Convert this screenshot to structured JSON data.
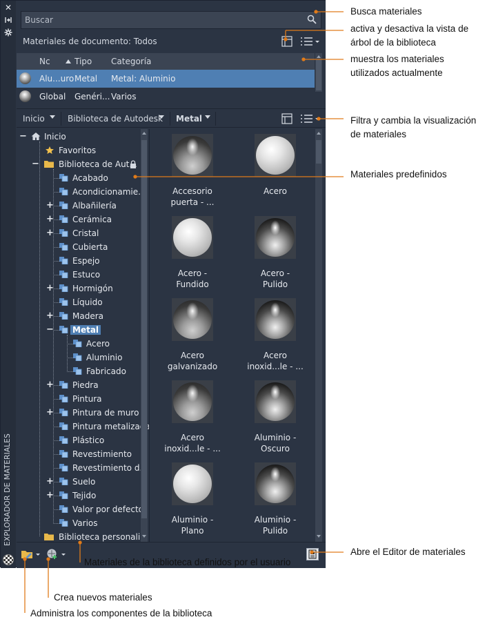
{
  "palette": {
    "title": "EXPLORADOR DE MATERIALES",
    "search": {
      "placeholder": "Buscar",
      "value": ""
    },
    "document": {
      "title": "Materiales de documento: Todos"
    },
    "doc_grid": {
      "columns": [
        "Nc",
        "Tipo",
        "Categoría"
      ],
      "rows": [
        {
          "name": "Alu...uro",
          "type": "Metal",
          "category": "Metal: Aluminio"
        },
        {
          "name": "Global",
          "type": "Genéri...",
          "category": "Varios"
        }
      ]
    },
    "library_bar": {
      "crumbs": [
        "Inicio",
        "Biblioteca de Autodesk",
        "Metal"
      ]
    },
    "tree": {
      "root": "Inicio",
      "favorites": "Favoritos",
      "autodesk_library": "Biblioteca de Aut...",
      "categories": [
        "Acabado",
        "Acondicionamie...",
        "Albañilería",
        "Cerámica",
        "Cristal",
        "Cubierta",
        "Espejo",
        "Estuco",
        "Hormigón",
        "Líquido",
        "Madera",
        "Metal",
        "Piedra",
        "Pintura",
        "Pintura de muro",
        "Pintura metalizada",
        "Plástico",
        "Revestimiento",
        "Revestimiento d...",
        "Suelo",
        "Tejido",
        "Valor por defecto",
        "Varios"
      ],
      "metal_children": [
        "Acero",
        "Aluminio",
        "Fabricado"
      ],
      "user_library": "Biblioteca personali..."
    },
    "swatches": [
      {
        "line1": "Accesorio",
        "line2": "puerta - ...",
        "finish": "chrome"
      },
      {
        "line1": "Acero",
        "line2": "",
        "finish": "satin"
      },
      {
        "line1": "Acero -",
        "line2": "Fundido",
        "finish": "satin"
      },
      {
        "line1": "Acero -",
        "line2": "Pulido",
        "finish": "polish"
      },
      {
        "line1": "Acero",
        "line2": "galvanizado",
        "finish": "chrome"
      },
      {
        "line1": "Acero",
        "line2": "inoxid...le - ...",
        "finish": "polish"
      },
      {
        "line1": "Acero",
        "line2": "inoxid...le - ...",
        "finish": "chrome"
      },
      {
        "line1": "Aluminio -",
        "line2": "Oscuro",
        "finish": "polish"
      },
      {
        "line1": "Aluminio -",
        "line2": "Plano",
        "finish": "satin"
      },
      {
        "line1": "Aluminio -",
        "line2": "Pulido",
        "finish": "polish"
      }
    ]
  },
  "callouts": {
    "search": "Busca materiales",
    "tree_toggle_1": "activa y desactiva la vista de",
    "tree_toggle_2": "árbol de la biblioteca",
    "in_use_1": "muestra los materiales",
    "in_use_2": "utilizados actualmente",
    "filter_1": "Filtra y cambia la visualización",
    "filter_2": "de materiales",
    "predefined": "Materiales predefinidos",
    "editor": "Abre el Editor de materiales",
    "user_lib": "Materiales de la biblioteca definidos por el usuario",
    "create": "Crea nuevos materiales",
    "manage": "Administra los componentes de la biblioteca"
  },
  "colors": {
    "panel": "#2b3443",
    "field": "#3b4453",
    "selection": "#4f7fb3",
    "annotation": "#e07b1a",
    "folder": "#e8b84a",
    "star": "#f2c14e",
    "tree_icon": "#5d8fc9"
  }
}
